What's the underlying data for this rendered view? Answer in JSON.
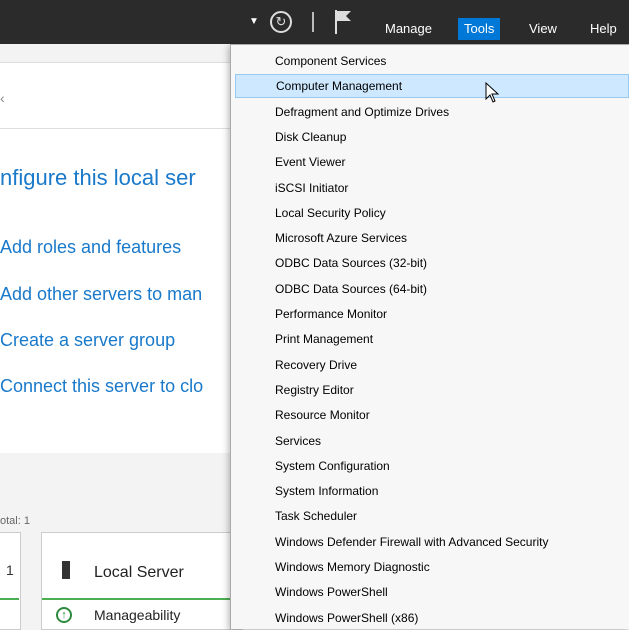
{
  "menubar": {
    "items": [
      {
        "label": "Manage",
        "active": false
      },
      {
        "label": "Tools",
        "active": true
      },
      {
        "label": "View",
        "active": false
      },
      {
        "label": "Help",
        "active": false
      }
    ],
    "icons": [
      "dropdown-arrow-icon",
      "refresh-icon",
      "flag-icon"
    ]
  },
  "main": {
    "configure_title": "nfigure this local ser",
    "tasks": [
      "Add roles and features",
      "Add other servers to man",
      "Create a server group",
      "Connect this server to clo"
    ],
    "total_label": "otal: 1",
    "left_tile_count": "1",
    "local_server_title": "Local Server",
    "manageability_label": "Manageability"
  },
  "tools_menu": {
    "hover_index": 1,
    "items": [
      "Component Services",
      "Computer Management",
      "Defragment and Optimize Drives",
      "Disk Cleanup",
      "Event Viewer",
      "iSCSI Initiator",
      "Local Security Policy",
      "Microsoft Azure Services",
      "ODBC Data Sources (32-bit)",
      "ODBC Data Sources (64-bit)",
      "Performance Monitor",
      "Print Management",
      "Recovery Drive",
      "Registry Editor",
      "Resource Monitor",
      "Services",
      "System Configuration",
      "System Information",
      "Task Scheduler",
      "Windows Defender Firewall with Advanced Security",
      "Windows Memory Diagnostic",
      "Windows PowerShell",
      "Windows PowerShell (x86)"
    ]
  },
  "colors": {
    "topbar": "#2b2b2b",
    "accent": "#0078d7",
    "link": "#1979ca",
    "hover": "#cde8ff",
    "status_green": "#4caf50"
  }
}
